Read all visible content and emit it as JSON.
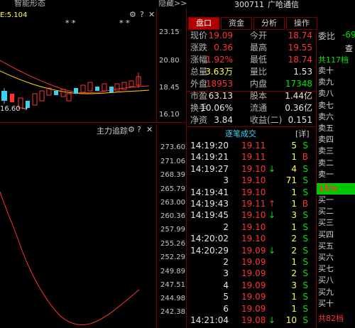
{
  "header": {
    "left_title": "智能形态",
    "hide_link": "隐藏>>",
    "stock_code": "300711",
    "stock_name": "广哈通信",
    "corner_label": "查"
  },
  "kline": {
    "ma_label": "E:5.104",
    "star_marks_1": "* *",
    "star_marks_2": "* *",
    "low_marker": "16.60",
    "y_ticks": [
      "23.15",
      "20.80",
      "18.45",
      "16.10"
    ],
    "icons": [
      "gear-icon",
      "help-icon",
      "close-icon"
    ]
  },
  "indicator": {
    "title": "主力追踪",
    "y_ticks": [
      "273.60",
      "271.06",
      "268.39",
      "265.79",
      "263.00",
      "260.36",
      "257.99",
      "255.26",
      "252.29",
      "249.89",
      "247.51",
      "244.98",
      "242.38"
    ]
  },
  "tabs": [
    {
      "label": "盘口",
      "active": true
    },
    {
      "label": "资金",
      "active": false
    },
    {
      "label": "分析",
      "active": false
    },
    {
      "label": "操作",
      "active": false
    }
  ],
  "quote": {
    "rows": [
      {
        "l1": "现价",
        "v1": "19.09",
        "c1": "red",
        "l2": "今开",
        "v2": "18.74",
        "c2": "red"
      },
      {
        "l1": "涨跌",
        "v1": "0.36",
        "c1": "red",
        "l2": "最高",
        "v2": "19.55",
        "c2": "red"
      },
      {
        "l1": "涨幅",
        "v1": "1.92%",
        "c1": "red",
        "l2": "最低",
        "v2": "18.74",
        "c2": "red"
      },
      {
        "l1": "总量",
        "v1": "3.63万",
        "c1": "yellow",
        "l2": "量比",
        "v2": "1.53",
        "c2": "white"
      },
      {
        "l1": "外盘",
        "v1": "18953",
        "c1": "red",
        "l2": "内盘",
        "v2": "17348",
        "c2": "green"
      }
    ],
    "rows2": [
      {
        "l1": "市盈",
        "v1": "63.13",
        "l2": "股本",
        "v2": "1.44亿"
      },
      {
        "l1": "换手",
        "v1": "10.06%",
        "l2": "流通",
        "v2": "0.36亿"
      },
      {
        "l1": "净资",
        "v1": "3.84",
        "l2": "收益(二)",
        "v2": "0.151"
      }
    ]
  },
  "trades": {
    "title": "逐笔成交",
    "detail_button": "[详]",
    "rows": [
      {
        "time": "14:19:20",
        "price": "19.11",
        "arrow": "",
        "vol": "5",
        "side": "S"
      },
      {
        "time": "14:19:21",
        "price": "19.11",
        "arrow": "",
        "vol": "1",
        "side": "B"
      },
      {
        "time": "14:19:27",
        "price": "19.10",
        "arrow": "↓",
        "vol": "4",
        "side": "S"
      },
      {
        "time": "3",
        "price": "19.10",
        "arrow": "",
        "vol": "71",
        "side": "S"
      },
      {
        "time": "14:19:41",
        "price": "19.10",
        "arrow": "",
        "vol": "1",
        "side": "S"
      },
      {
        "time": "14:19:43",
        "price": "19.11",
        "arrow": "↑",
        "vol": "1",
        "side": "B"
      },
      {
        "time": "14:19:45",
        "price": "19.10",
        "arrow": "↓",
        "vol": "3",
        "side": "S"
      },
      {
        "time": "2",
        "price": "19.10",
        "arrow": "",
        "vol": "1",
        "side": "S"
      },
      {
        "time": "14:20:02",
        "price": "19.10",
        "arrow": "",
        "vol": "2",
        "side": "S"
      },
      {
        "time": "14:20:29",
        "price": "19.09",
        "arrow": "↓",
        "vol": "2",
        "side": "S"
      },
      {
        "time": "2",
        "price": "19.09",
        "arrow": "",
        "vol": "1",
        "side": "S"
      },
      {
        "time": "3",
        "price": "19.09",
        "arrow": "",
        "vol": "2",
        "side": "S"
      },
      {
        "time": "4",
        "price": "19.09",
        "arrow": "",
        "vol": "3",
        "side": "S"
      },
      {
        "time": "5",
        "price": "19.09",
        "arrow": "",
        "vol": "1",
        "side": "S"
      },
      {
        "time": "6",
        "price": "19.09",
        "arrow": "",
        "vol": "1",
        "side": "S"
      },
      {
        "time": "14:21:04",
        "price": "19.08",
        "arrow": "↓",
        "vol": "10",
        "side": "S"
      }
    ]
  },
  "orderbook": {
    "ratio_label": "委比",
    "ratio_value": "-69",
    "sell_total": "共117档",
    "sell_levels": [
      "卖十",
      "卖九",
      "卖八",
      "卖七",
      "卖六",
      "卖五",
      "卖四",
      "卖三",
      "卖二",
      "卖一"
    ],
    "mid_pct": "15%",
    "buy_levels": [
      "买一",
      "买二",
      "买三",
      "买四",
      "买五",
      "买六",
      "买七",
      "买八",
      "买九",
      "买十"
    ],
    "buy_total": "共82档"
  }
}
